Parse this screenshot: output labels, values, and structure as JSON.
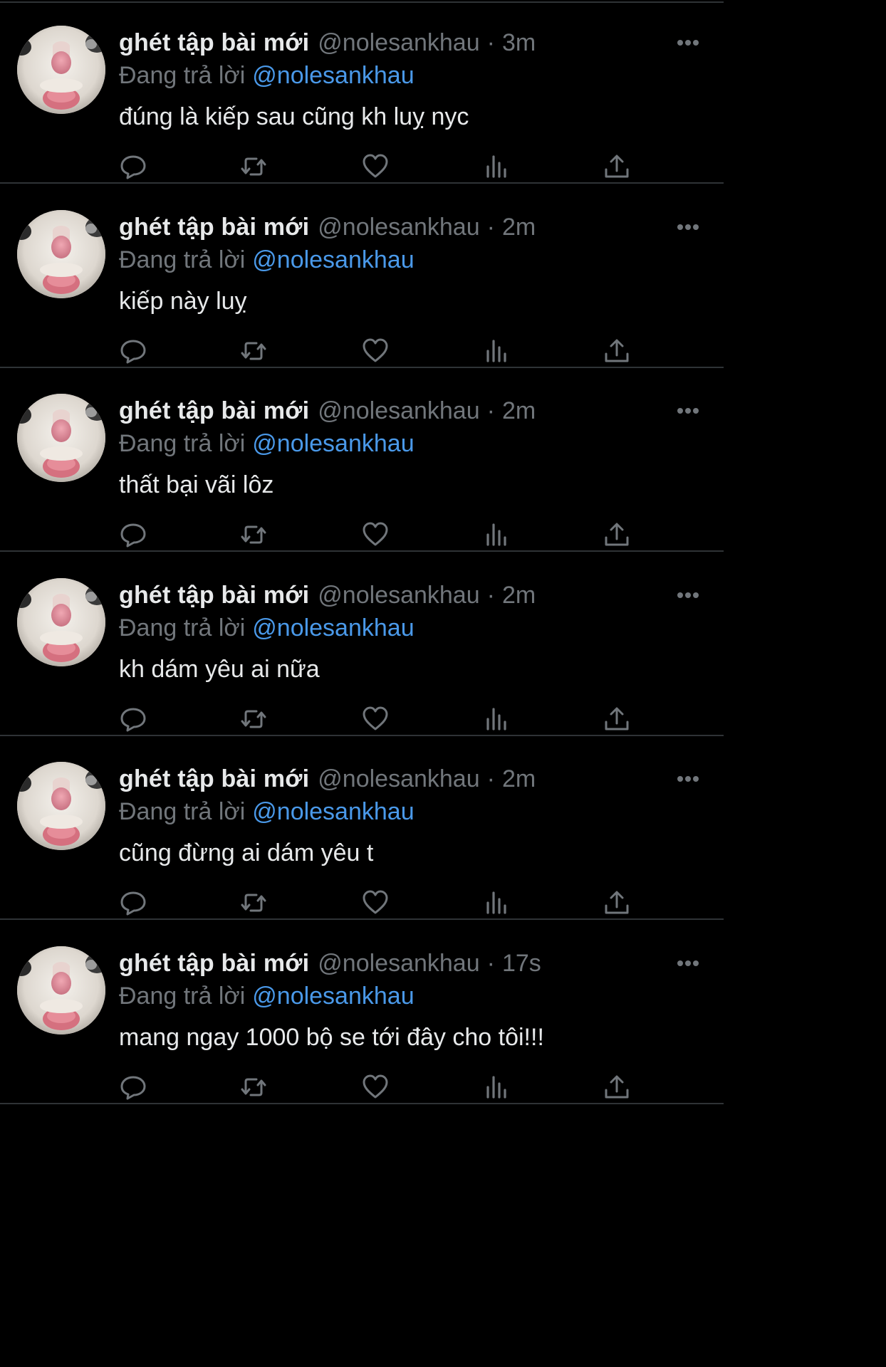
{
  "colors": {
    "background": "#000000",
    "text_primary": "#e7e9ea",
    "text_secondary": "#71767b",
    "mention": "#4a99e9",
    "divider": "#2f3336"
  },
  "icons": {
    "more": "more-horizontal-icon",
    "reply": "reply-bubble-icon",
    "retweet": "retweet-icon",
    "like": "heart-icon",
    "stats": "bar-chart-icon",
    "share": "share-upload-icon",
    "avatar": "cat-avatar-image"
  },
  "tweets": [
    {
      "display_name": "ghét tập bài mới",
      "handle": "@nolesankhau",
      "separator": "·",
      "time": "3m",
      "reply_prefix": "Đang trả lời",
      "reply_to": "@nolesankhau",
      "text": "đúng là kiếp sau cũng kh luỵ nyc"
    },
    {
      "display_name": "ghét tập bài mới",
      "handle": "@nolesankhau",
      "separator": "·",
      "time": "2m",
      "reply_prefix": "Đang trả lời",
      "reply_to": "@nolesankhau",
      "text": "kiếp này luỵ"
    },
    {
      "display_name": "ghét tập bài mới",
      "handle": "@nolesankhau",
      "separator": "·",
      "time": "2m",
      "reply_prefix": "Đang trả lời",
      "reply_to": "@nolesankhau",
      "text": "thất bại vãi lôz"
    },
    {
      "display_name": "ghét tập bài mới",
      "handle": "@nolesankhau",
      "separator": "·",
      "time": "2m",
      "reply_prefix": "Đang trả lời",
      "reply_to": "@nolesankhau",
      "text": "kh dám yêu ai nữa"
    },
    {
      "display_name": "ghét tập bài mới",
      "handle": "@nolesankhau",
      "separator": "·",
      "time": "2m",
      "reply_prefix": "Đang trả lời",
      "reply_to": "@nolesankhau",
      "text": "cũng đừng ai dám yêu t"
    },
    {
      "display_name": "ghét tập bài mới",
      "handle": "@nolesankhau",
      "separator": "·",
      "time": "17s",
      "reply_prefix": "Đang trả lời",
      "reply_to": "@nolesankhau",
      "text": "mang ngay 1000 bộ se tới đây cho tôi!!!"
    }
  ]
}
